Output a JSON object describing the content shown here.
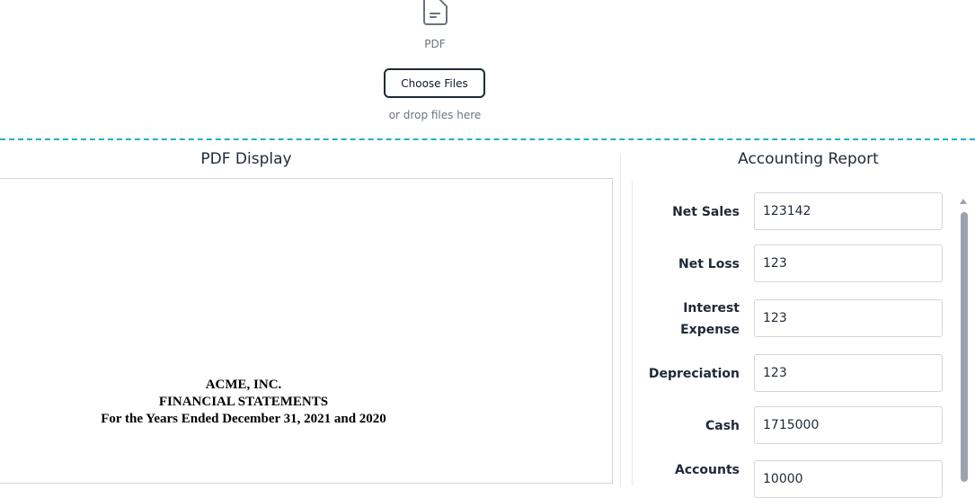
{
  "upload": {
    "icon": "file-text-icon",
    "file_type_label": "PDF",
    "choose_button_label": "Choose Files",
    "drop_hint": "or drop files here",
    "separator_color": "#22b0c8"
  },
  "pdf_display": {
    "title": "PDF Display",
    "document_lines": [
      "ACME, INC.",
      "FINANCIAL STATEMENTS",
      "For the Years Ended December 31, 2021 and 2020"
    ]
  },
  "accounting_report": {
    "title": "Accounting Report",
    "fields": [
      {
        "label": "Net Sales",
        "value": "123142"
      },
      {
        "label": "Net Loss",
        "value": "123"
      },
      {
        "label": "Interest Expense",
        "value": "123"
      },
      {
        "label": "Depreciation",
        "value": "123"
      },
      {
        "label": "Cash",
        "value": "1715000"
      },
      {
        "label": "Accounts",
        "value": "10000"
      }
    ]
  }
}
